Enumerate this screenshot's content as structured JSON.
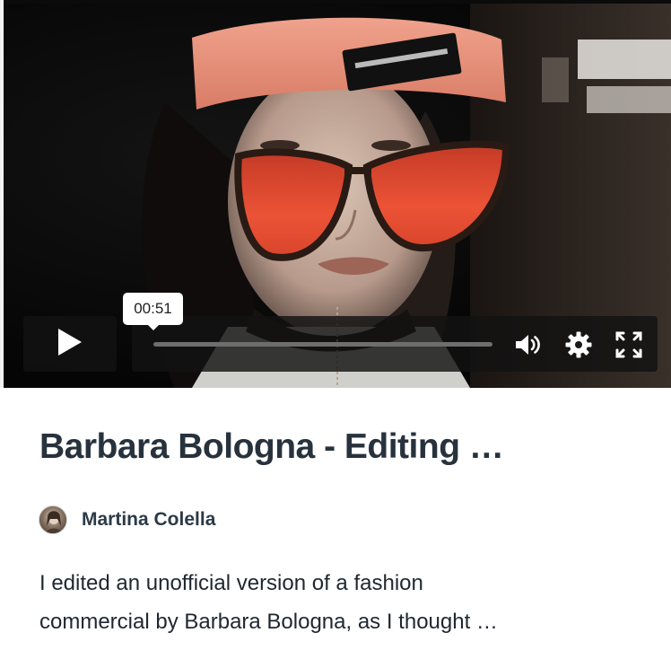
{
  "video": {
    "current_time": "00:51",
    "progress_fraction": 0.0,
    "icons": {
      "play": "play-icon",
      "volume": "volume-icon",
      "settings": "gear-icon",
      "fullscreen": "fullscreen-icon"
    }
  },
  "post": {
    "title": "Barbara Bologna - Editing …",
    "author": "Martina Colella",
    "description_line1": "I edited an unofficial version of a fashion",
    "description_line2": "commercial by Barbara Bologna, as I thought …"
  },
  "colors": {
    "title": "#27323d",
    "author": "#2c3a47",
    "body_text": "#1f2730",
    "control_bg": "#121212",
    "headband": "#e8937f",
    "lens": "#e8432a"
  }
}
